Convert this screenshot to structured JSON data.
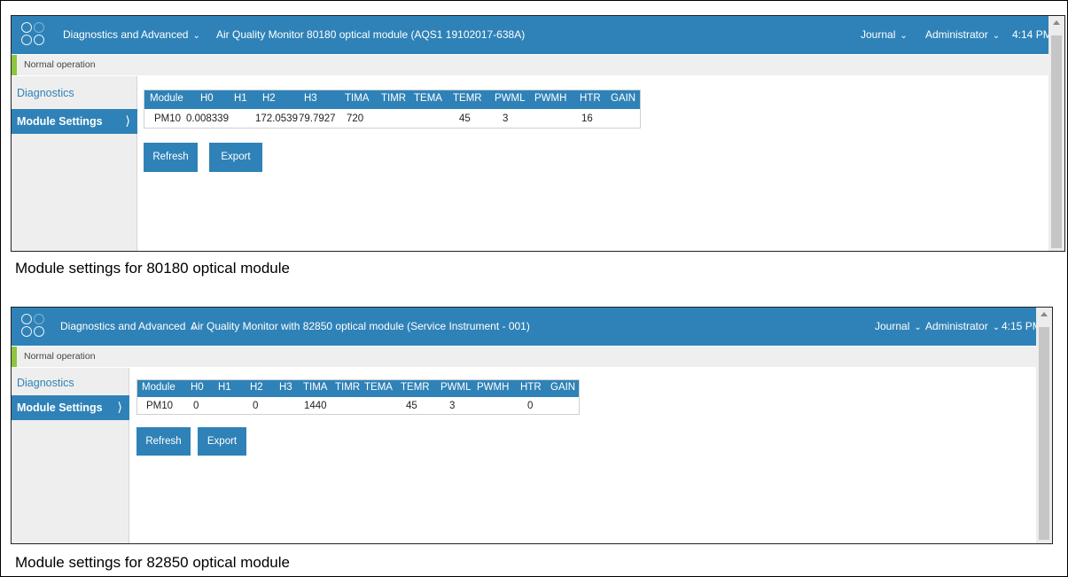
{
  "screens": [
    {
      "menu_label": "Diagnostics and Advanced",
      "instrument_title": "Air Quality Monitor 80180 optical module (AQS1 19102017-638A)",
      "journal_label": "Journal",
      "user_label": "Administrator",
      "time": "4:14 PM",
      "status_text": "Normal operation",
      "sidebar": {
        "diagnostics_label": "Diagnostics",
        "module_settings_label": "Module Settings"
      },
      "table": {
        "headers": [
          "Module",
          "H0",
          "H1",
          "H2",
          "H3",
          "TIMA",
          "TIMR",
          "TEMA",
          "TEMR",
          "PWML",
          "PWMH",
          "HTR",
          "GAIN"
        ],
        "row": [
          "PM10",
          "0.008339",
          "",
          "172.0539",
          "79.7927",
          "720",
          "",
          "",
          "45",
          "3",
          "",
          "16",
          ""
        ]
      },
      "refresh_label": "Refresh",
      "export_label": "Export",
      "caption": "Module settings for 80180 optical module"
    },
    {
      "menu_label": "Diagnostics and Advanced",
      "instrument_title": "Air Quality Monitor with 82850 optical module (Service Instrument - 001)",
      "journal_label": "Journal",
      "user_label": "Administrator",
      "time": "4:15 PM",
      "status_text": "Normal operation",
      "sidebar": {
        "diagnostics_label": "Diagnostics",
        "module_settings_label": "Module Settings"
      },
      "table": {
        "headers": [
          "Module",
          "H0",
          "H1",
          "H2",
          "H3",
          "TIMA",
          "TIMR",
          "TEMA",
          "TEMR",
          "PWML",
          "PWMH",
          "HTR",
          "GAIN"
        ],
        "row": [
          "PM10",
          "0",
          "",
          "0",
          "",
          "1440",
          "",
          "",
          "45",
          "3",
          "",
          "0",
          ""
        ]
      },
      "refresh_label": "Refresh",
      "export_label": "Export",
      "caption": "Module settings for 82850 optical module"
    }
  ],
  "colors": {
    "accent": "#2f82b7",
    "status_ok": "#8cc63e",
    "sidebar_bg": "#eeeeee"
  },
  "icons": {
    "logo": "app-logo-icon",
    "dropdown": "chevron-down-icon",
    "nav_arrow": "chevron-right-icon"
  }
}
